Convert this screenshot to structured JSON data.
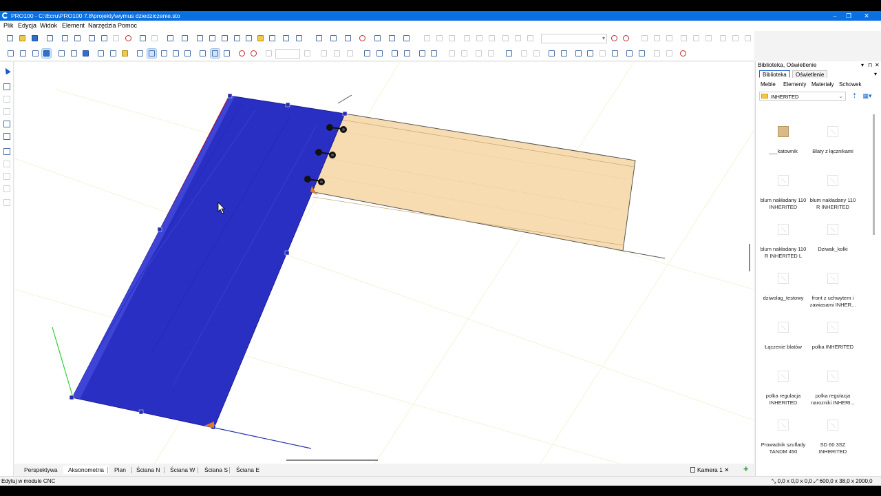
{
  "window": {
    "title": "PRO100 - C:\\Ecru\\PRO100 7.8\\projekty\\wymus dziedziczenie.sto",
    "controls": [
      "–",
      "❐",
      "✕"
    ]
  },
  "menu": [
    "Plik",
    "Edycja",
    "Widok",
    "Element",
    "Narzędzia",
    "Pomoc"
  ],
  "view_tabs": [
    {
      "label": "Perspektywa",
      "active": false
    },
    {
      "label": "Aksonometria",
      "active": true
    },
    {
      "label": "Plan",
      "active": false
    },
    {
      "label": "Ściana N",
      "active": false
    },
    {
      "label": "Ściana W",
      "active": false
    },
    {
      "label": "Ściana S",
      "active": false
    },
    {
      "label": "Ściana E",
      "active": false
    }
  ],
  "camera_tab": {
    "label": "Kamera 1",
    "close": "✕",
    "add": "+"
  },
  "status": {
    "text": "Edytuj w module CNC",
    "position": "0,0 x 0,0 x 0,0",
    "dimensions": "600,0 x 38,0 x 2000,0"
  },
  "panel": {
    "title": "Biblioteka, Oświetlenie",
    "controls": [
      "▾",
      "⊓",
      "✕"
    ],
    "tabs": [
      {
        "label": "Biblioteka",
        "active": true
      },
      {
        "label": "Oświetlenie",
        "active": false
      }
    ],
    "subtabs": [
      {
        "label": "Meble",
        "active": true
      },
      {
        "label": "Elementy",
        "active": false
      },
      {
        "label": "Materiały",
        "active": false
      },
      {
        "label": "Schowek",
        "active": false
      }
    ],
    "folder": "INHERITED",
    "items": [
      {
        "label": "___katownik",
        "icon": "box"
      },
      {
        "label": "Blaty z łącznikami",
        "icon": "placeholder"
      },
      {
        "label": "blum nakładany 110 INHERITED",
        "icon": "placeholder"
      },
      {
        "label": "blum nakładany 110 R INHERITED",
        "icon": "placeholder"
      },
      {
        "label": "blum nakładany 110 R INHERITED L",
        "icon": "placeholder"
      },
      {
        "label": "Dziwak_kolki",
        "icon": "placeholder"
      },
      {
        "label": "dziwolag_testowy",
        "icon": "placeholder"
      },
      {
        "label": "front z uchwytem i zawiasami INHER...",
        "icon": "placeholder"
      },
      {
        "label": "Łączenie blatów",
        "icon": "placeholder"
      },
      {
        "label": "polka INHERITED",
        "icon": "placeholder"
      },
      {
        "label": "polka regulacja INHERITED",
        "icon": "placeholder"
      },
      {
        "label": "polka regulacja narozniki INHERI...",
        "icon": "placeholder"
      },
      {
        "label": "Prowadnik szuflady TANDM 450",
        "icon": "placeholder"
      },
      {
        "label": "SD 60 3SZ INHERITED",
        "icon": "placeholder"
      }
    ]
  },
  "scene": {
    "selected_element_color": "#2a2fc4",
    "wood_color": "#f7dcb2",
    "connectors": 3
  }
}
